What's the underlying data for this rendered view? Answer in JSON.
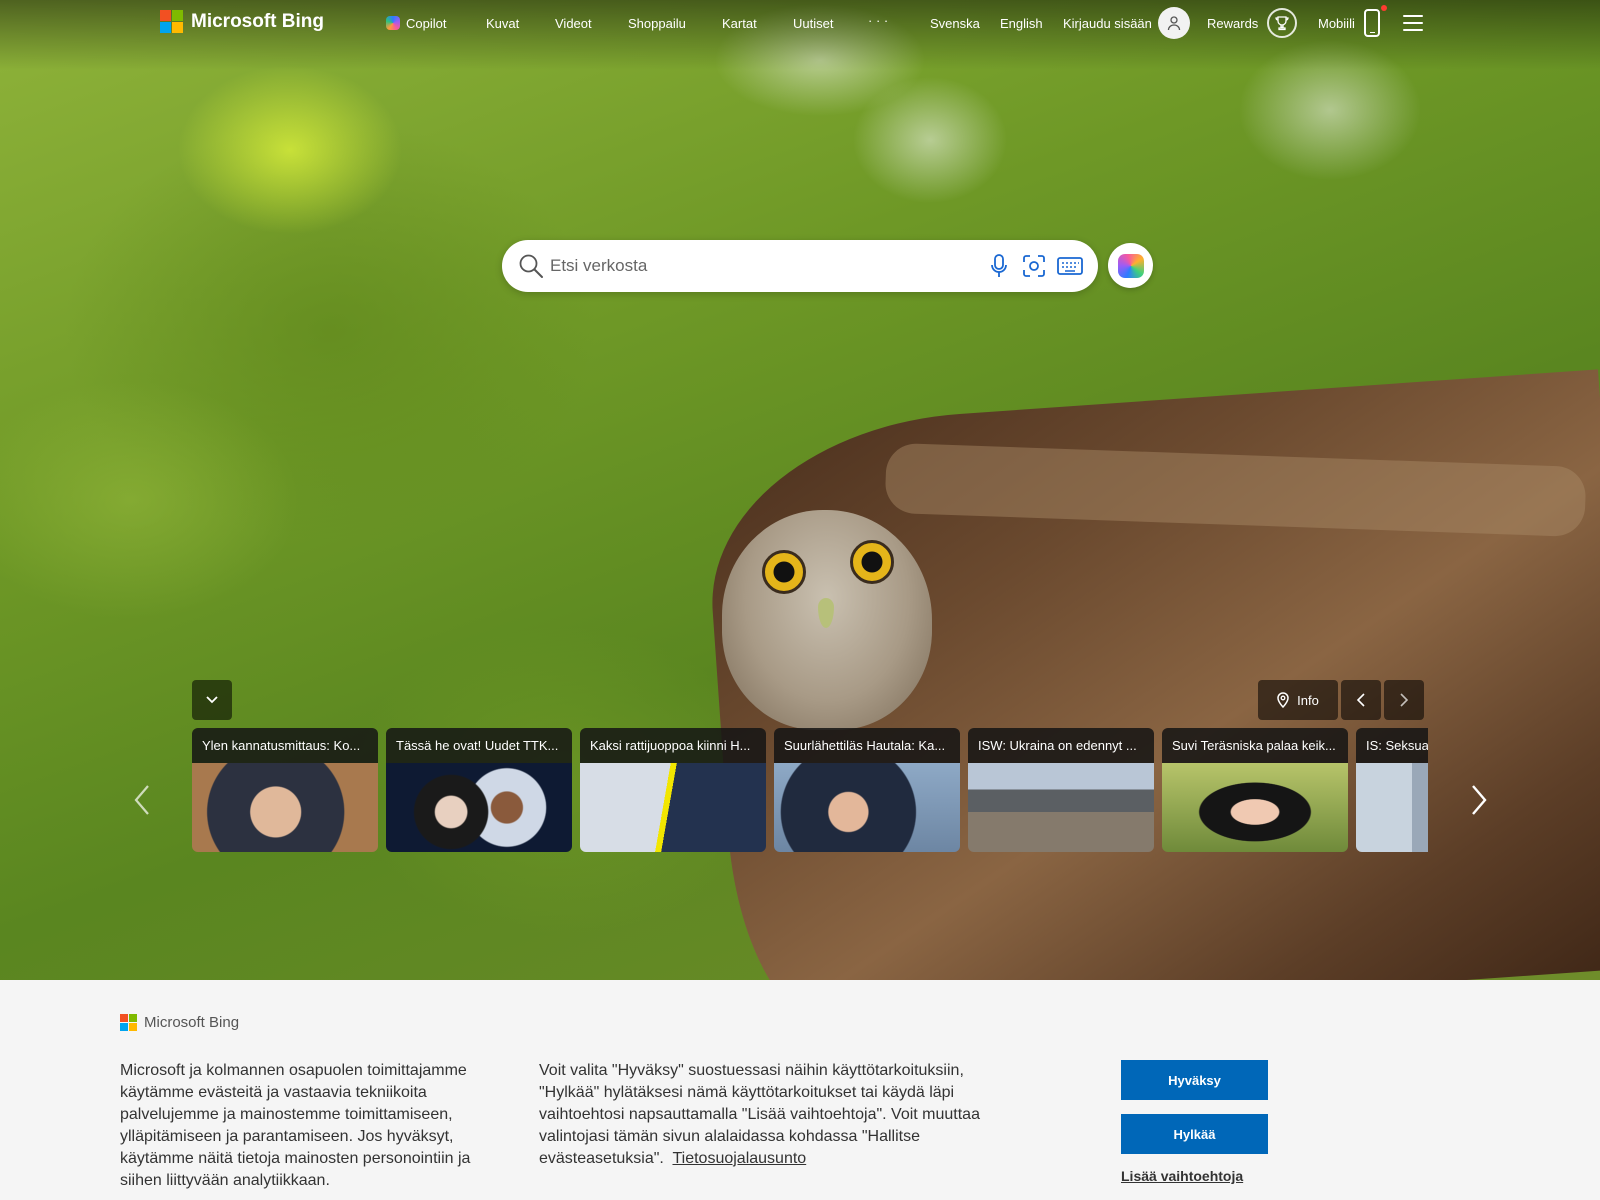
{
  "header": {
    "logo_text": "Microsoft Bing",
    "nav": [
      "Copilot",
      "Kuvat",
      "Videot",
      "Shoppailu",
      "Kartat",
      "Uutiset",
      "· · ·"
    ],
    "lang_svenska": "Svenska",
    "lang_english": "English",
    "sign_in": "Kirjaudu sisään",
    "rewards": "Rewards",
    "mobile": "Mobiili"
  },
  "search": {
    "placeholder": "Etsi verkosta",
    "icons": [
      "search-icon",
      "microphone-icon",
      "visual-search-icon",
      "keyboard-icon"
    ]
  },
  "carousel": {
    "info_label": "Info",
    "tiles": [
      {
        "title": "Ylen kannatusmittaus: Ko..."
      },
      {
        "title": "Tässä he ovat! Uudet TTK..."
      },
      {
        "title": "Kaksi rattijuoppoa kiinni H..."
      },
      {
        "title": "Suurlähettiläs Hautala: Ka..."
      },
      {
        "title": "ISW: Ukraina on edennyt ..."
      },
      {
        "title": "Suvi Teräsniska palaa keik..."
      },
      {
        "title": "IS: Seksua"
      }
    ]
  },
  "consent": {
    "logo_text": "Microsoft Bing",
    "text_left": "Microsoft ja kolmannen osapuolen toimittajamme käytämme evästeitä ja vastaavia tekniikoita palvelujemme ja mainostemme toimittamiseen, ylläpitämiseen ja parantamiseen. Jos hyväksyt, käytämme näitä tietoja mainosten personointiin ja siihen liittyvään analytiikkaan.",
    "text_right": "Voit valita \"Hyväksy\" suostuessasi näihin käyttötarkoituksiin, \"Hylkää\" hylätäksesi nämä käyttötarkoitukset tai käydä läpi vaihtoehtosi napsauttamalla \"Lisää vaihtoehtoja\". Voit muuttaa valintojasi tämän sivun alalaidassa kohdassa \"Hallitse evästeasetuksia\".",
    "privacy_link": "Tietosuojalausunto",
    "accept": "Hyväksy",
    "reject": "Hylkää",
    "more_options": "Lisää vaihtoehtoja"
  },
  "colors": {
    "primary_button": "#0067b8",
    "consent_background": "#f5f5f5"
  }
}
